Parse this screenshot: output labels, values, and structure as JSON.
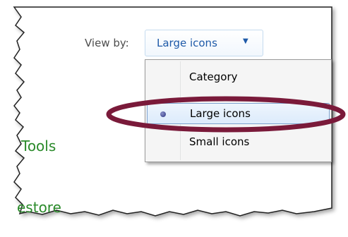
{
  "toolbar": {
    "view_by_label": "View by:",
    "view_value": "Large icons",
    "dropdown_icon": "chevron-down-icon"
  },
  "menu": {
    "items": [
      {
        "label": "Category",
        "selected": false
      },
      {
        "label": "Large icons",
        "selected": true
      },
      {
        "label": "Small icons",
        "selected": false
      }
    ]
  },
  "background_links": [
    "Tools",
    "estore"
  ],
  "colors": {
    "link_green": "#2a8a2a",
    "dropdown_text": "#1e5aa8",
    "highlight_ellipse": "#7a1a3a"
  }
}
